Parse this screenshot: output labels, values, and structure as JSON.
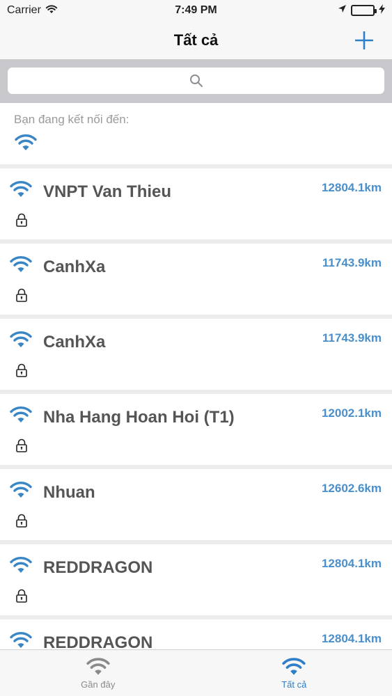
{
  "status_bar": {
    "carrier": "Carrier",
    "time": "7:49 PM"
  },
  "nav": {
    "title": "Tất cả",
    "add_icon": "plus-icon"
  },
  "search": {
    "icon": "search-icon",
    "placeholder": ""
  },
  "connected": {
    "label": "Bạn đang kết nối đến:"
  },
  "networks": [
    {
      "name": "VNPT Van Thieu",
      "distance": "12804.1km"
    },
    {
      "name": "CanhXa",
      "distance": "11743.9km"
    },
    {
      "name": "CanhXa",
      "distance": "11743.9km"
    },
    {
      "name": "Nha Hang Hoan Hoi (T1)",
      "distance": "12002.1km"
    },
    {
      "name": "Nhuan",
      "distance": "12602.6km"
    },
    {
      "name": "REDDRAGON",
      "distance": "12804.1km"
    },
    {
      "name": "REDDRAGON",
      "distance": "12804.1km"
    }
  ],
  "tabs": [
    {
      "label": "Gần đây",
      "icon": "wifi-icon"
    },
    {
      "label": "Tất cả",
      "icon": "wifi-icon"
    }
  ],
  "colors": {
    "accent": "#2f7fc8",
    "wifi_blue": "#3a86c4",
    "distance": "#4a8fc9",
    "inactive": "#8a8a8a"
  }
}
